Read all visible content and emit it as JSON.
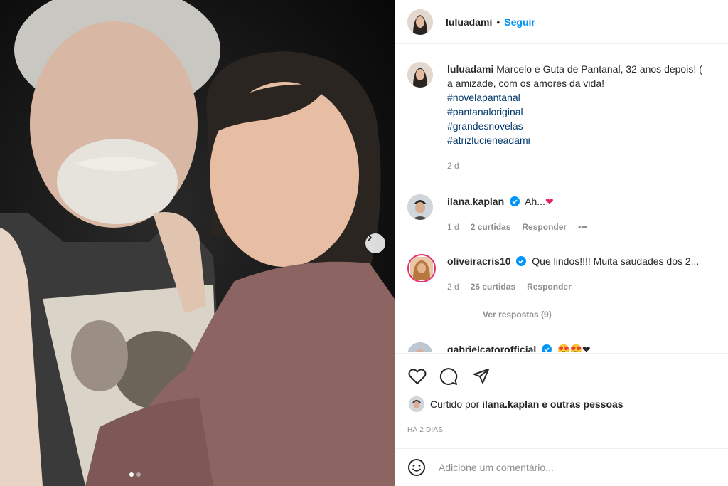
{
  "post": {
    "author": "luluadami",
    "follow_label": "Seguir",
    "separator": "•"
  },
  "caption": {
    "username": "luluadami",
    "line1": "Marcelo e Guta de Pantanal, 32 anos depois! (",
    "line2": "a amizade, com os amores da vida!",
    "hashtags": [
      "#novelapantanal",
      "#pantanaloriginal",
      "#grandesnovelas",
      "#atrizlucieneadami"
    ],
    "time": "2 d"
  },
  "comments": [
    {
      "username": "ilana.kaplan",
      "verified": true,
      "text": "Ah...",
      "emoji": "❤",
      "time": "1 d",
      "likes": "2 curtidas",
      "reply": "Responder",
      "more": "•••"
    },
    {
      "username": "oliveiracris10",
      "verified": true,
      "text": "Que lindos!!!! Muita saudades dos 2...",
      "time": "2 d",
      "likes": "26 curtidas",
      "reply": "Responder"
    },
    {
      "username": "gabrielcatorofficial",
      "verified": true,
      "text": "😍😍❤"
    }
  ],
  "view_replies": "Ver respostas (9)",
  "liked_by": {
    "prefix": "Curtido por",
    "user": "ilana.kaplan",
    "suffix": "e outras pessoas"
  },
  "timestamp": "HÁ 2 DIAS",
  "add_comment": {
    "placeholder": "Adicione um comentário..."
  },
  "icons": {
    "like": "heart-icon",
    "comment": "comment-icon",
    "share": "share-icon",
    "emoji": "emoji-icon",
    "next": "chevron-right-icon",
    "verified": "verified-badge-icon"
  },
  "colors": {
    "link": "#00376b",
    "follow": "#0095f6",
    "verified": "#0095f6",
    "heart": "#e0245e"
  }
}
